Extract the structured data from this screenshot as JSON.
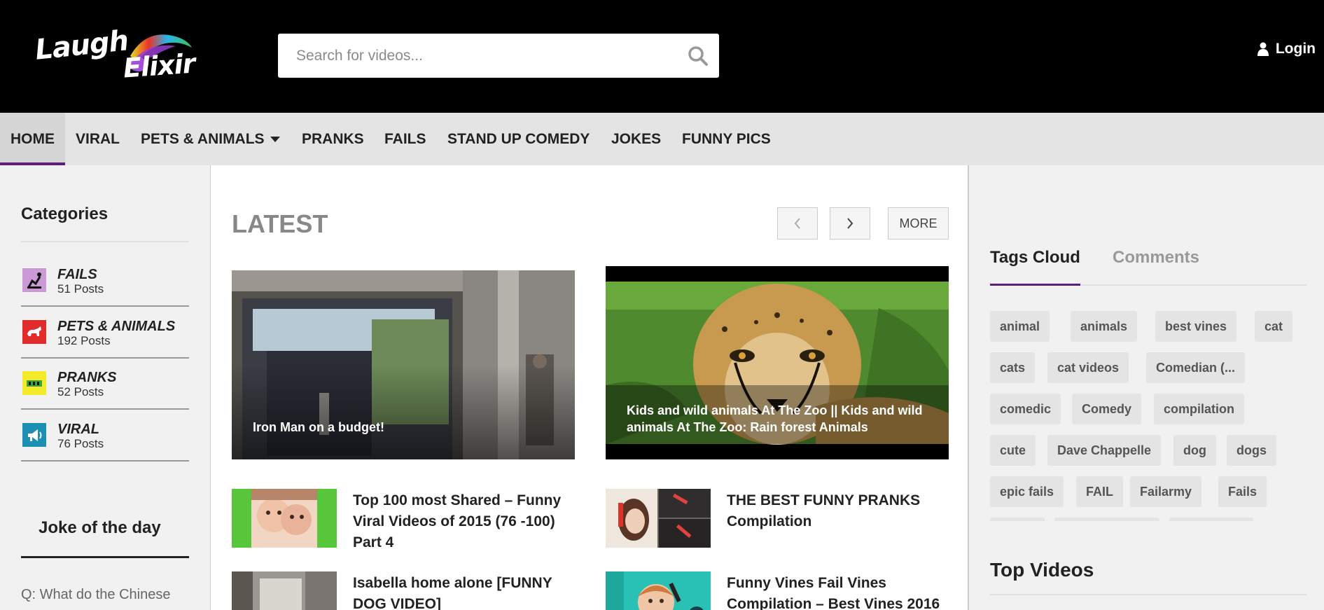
{
  "brand": {
    "logo_line1": "Laugh",
    "logo_line2": "Elixir"
  },
  "search": {
    "placeholder": "Search for videos..."
  },
  "header": {
    "login_label": "Login"
  },
  "nav": {
    "items": [
      "HOME",
      "VIRAL",
      "PETS & ANIMALS",
      "PRANKS",
      "FAILS",
      "STAND UP COMEDY",
      "JOKES",
      "FUNNY PICS"
    ],
    "active": "HOME",
    "accent": "#5b1f7a"
  },
  "sidebar": {
    "categories_title": "Categories",
    "categories": [
      {
        "name": "FAILS",
        "count": "51 Posts",
        "color": "#c99ad6"
      },
      {
        "name": "PETS & ANIMALS",
        "count": "192 Posts",
        "color": "#e22b2b"
      },
      {
        "name": "PRANKS",
        "count": "52 Posts",
        "color": "#f2ea2b"
      },
      {
        "name": "VIRAL",
        "count": "76 Posts",
        "color": "#1d8fb4"
      }
    ],
    "joke_title": "Joke of the day",
    "joke_text": "Q: What do the Chinese"
  },
  "main": {
    "section_title": "LATEST",
    "more_label": "MORE",
    "featured": [
      {
        "title": "Iron Man on a budget!"
      },
      {
        "title": "Kids and wild animals At The Zoo || Kids and wild animals At The Zoo: Rain forest Animals"
      }
    ],
    "posts": [
      {
        "title": "Top 100 most Shared – Funny Viral Videos of 2015 (76 -100) Part 4"
      },
      {
        "title": "THE BEST FUNNY PRANKS Compilation"
      },
      {
        "title": "Isabella home alone [FUNNY DOG VIDEO]"
      },
      {
        "title": "Funny Vines Fail Vines Compilation – Best Vines 2016"
      }
    ]
  },
  "right": {
    "tabs": [
      "Tags Cloud",
      "Comments"
    ],
    "tags": [
      "animal",
      "animals",
      "best vines",
      "cat",
      "cats",
      "cat videos",
      "Comedian (...",
      "comedic",
      "Comedy",
      "compilation",
      "cute",
      "Dave Chappelle",
      "dog",
      "dogs",
      "epic fails",
      "FAIL",
      "Failarmy",
      "Fails"
    ],
    "top_videos_title": "Top Videos"
  }
}
